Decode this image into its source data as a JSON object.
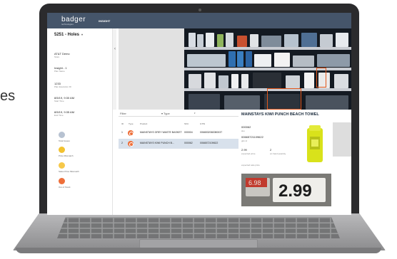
{
  "page": {
    "side_text": "es"
  },
  "header": {
    "logo": "badger",
    "logo_sub": "technologies",
    "nav": "INSIGHT"
  },
  "sidebar": {
    "store": "5251 - Holes",
    "store_caret": "▾",
    "info": [
      {
        "value": "AT&T Demo",
        "label": "Store"
      },
      {
        "value": "Insight - 1",
        "label": "Plan Name"
      },
      {
        "value": "1233",
        "label": "Plan Execution ID"
      },
      {
        "value": "8/5/19, 9:30 AM",
        "label": "Start Time"
      },
      {
        "value": "8/5/19, 9:35 AM",
        "label": "End Time"
      }
    ],
    "legend": [
      {
        "label": "Total Issues",
        "color": "#b7c2d1"
      },
      {
        "label": "Price Mismatch",
        "color": "#f2c230"
      },
      {
        "label": "Sales Price Mismatch",
        "color": "#f6c84a"
      },
      {
        "label": "Out of Stock",
        "color": "#ee6f3a"
      }
    ]
  },
  "photo": {
    "collapse_chevron": "‹"
  },
  "table": {
    "filter_placeholder": "Filter",
    "type_label": "▾  Type",
    "type_caret": "▾",
    "headers": [
      "ID",
      "Type",
      "Product",
      "SKU",
      "GTIN"
    ],
    "rows": [
      {
        "id": "1",
        "product": "MAINSTAYS GREY WASTE BASKET",
        "sku": "000004",
        "gtin": "0066532060080037"
      },
      {
        "id": "2",
        "product": "MAINSTAYS KIWI PUNCH B...",
        "sku": "000062",
        "gtin": "0066572109622"
      }
    ]
  },
  "detail": {
    "title": "MAINSTAYS KIWI PUNCH BEACH TOWEL",
    "sku_value": "000062",
    "sku_label": "sku",
    "gtin_value": "00665721109622",
    "gtin_label": "gtin id",
    "expected_price_value": "2.99",
    "expected_price_label": "expected price",
    "on_hand_value": "2",
    "on_hand_label": "on hand quantity",
    "sale_price_label": "expected sale price",
    "tag_old_price": "6.98",
    "tag_price": "2.99"
  },
  "colors": {
    "header": "#45556a",
    "out_of_stock": "#ee6f3a",
    "selected_row": "#d8e1ec",
    "highlight": "#e2571b"
  }
}
